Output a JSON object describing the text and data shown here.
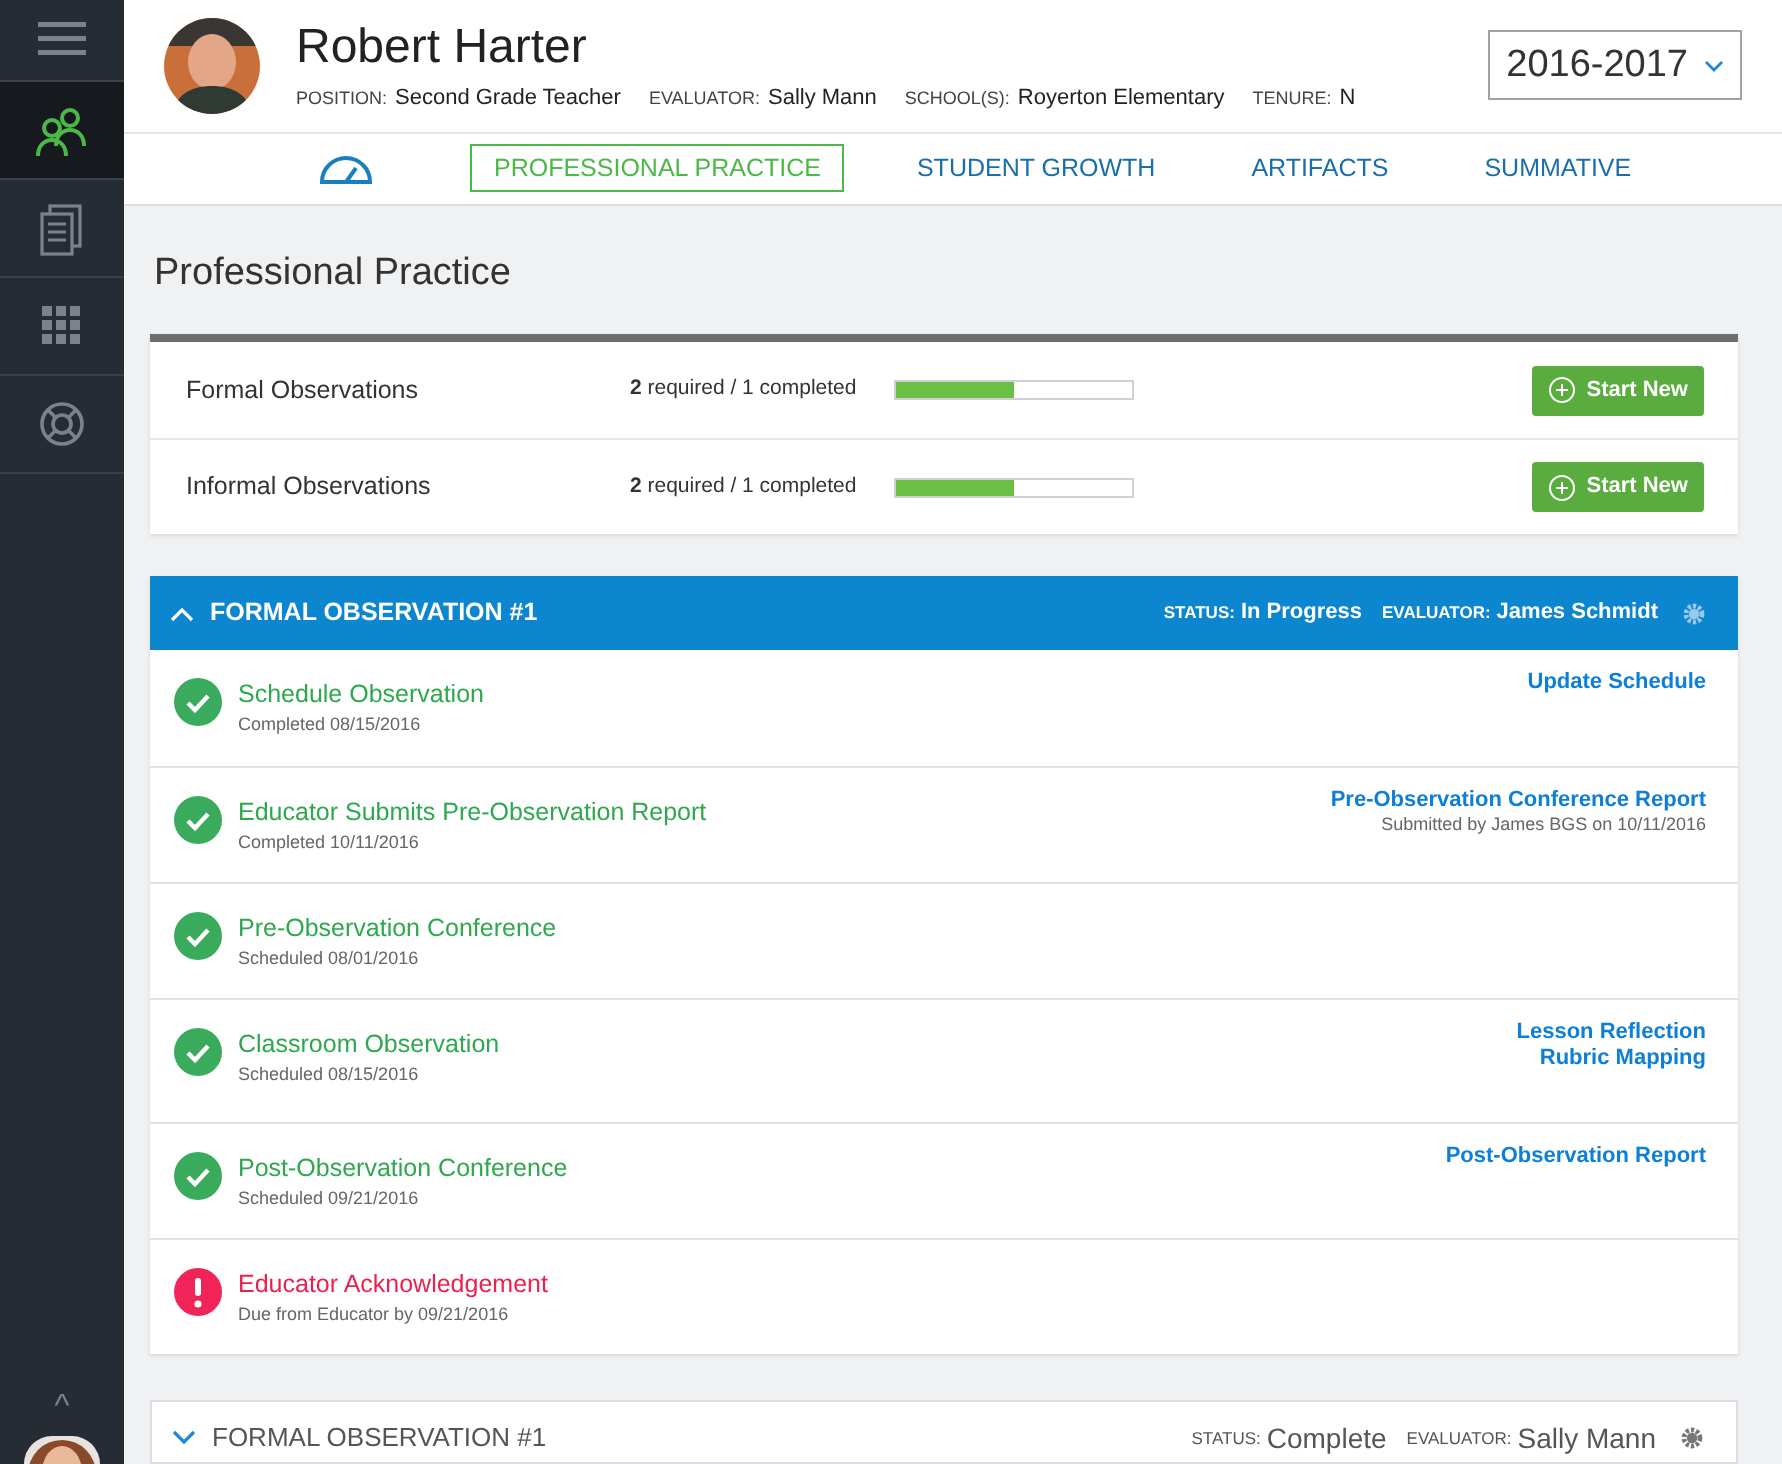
{
  "sidebar": {
    "items": [
      {
        "selected": false
      },
      {
        "selected": true
      },
      {
        "selected": false
      },
      {
        "selected": false
      },
      {
        "selected": false
      }
    ],
    "collapse": "^"
  },
  "profile": {
    "name": "Robert Harter",
    "fields": [
      {
        "label": "POSITION:",
        "value": "Second Grade Teacher"
      },
      {
        "label": "EVALUATOR:",
        "value": "Sally Mann"
      },
      {
        "label": "SCHOOL(S):",
        "value": "Royerton Elementary"
      },
      {
        "label": "TENURE:",
        "value": "N"
      }
    ],
    "year": "2016-2017"
  },
  "tabs": [
    {
      "kind": "icon",
      "selected": false
    },
    {
      "label": "PROFESSIONAL PRACTICE",
      "selected": true
    },
    {
      "label": "STUDENT GROWTH",
      "selected": false
    },
    {
      "label": "ARTIFACTS",
      "selected": false
    },
    {
      "label": "SUMMATIVE",
      "selected": false
    }
  ],
  "page_title": "Professional Practice",
  "summary": [
    {
      "name": "Formal Observations",
      "required": "2",
      "progress": "required / 1 completed",
      "level": 0.5,
      "button": "Start New"
    },
    {
      "name": "Informal Observations",
      "required": "2",
      "progress": "required / 1 completed",
      "level": 0.5,
      "button": "Start New"
    }
  ],
  "observations": [
    {
      "title": "FORMAL OBSERVATION #1",
      "expanded": true,
      "status_label": "STATUS:",
      "status": "In Progress",
      "evaluator_label": "EVALUATOR:",
      "evaluator": "James Schmidt",
      "steps": [
        {
          "kind": "done",
          "title": "Schedule Observation",
          "detail": "Completed 08/15/2016",
          "links": [
            "Update Schedule"
          ]
        },
        {
          "kind": "done",
          "title": "Educator Submits Pre-Observation Report",
          "detail": "Completed 10/11/2016",
          "links": [
            "Pre-Observation Conference Report"
          ],
          "note": "Submitted by James BGS on 10/11/2016"
        },
        {
          "kind": "done",
          "title": "Pre-Observation Conference",
          "detail": "Scheduled 08/01/2016"
        },
        {
          "kind": "done",
          "title": "Classroom Observation",
          "detail": "Scheduled 08/15/2016",
          "links": [
            "Lesson Reflection",
            "Rubric Mapping"
          ]
        },
        {
          "kind": "done",
          "title": "Post-Observation Conference",
          "detail": "Scheduled 09/21/2016",
          "links": [
            "Post-Observation Report"
          ]
        },
        {
          "kind": "alert",
          "title": "Educator Acknowledgement",
          "detail": "Due from Educator by 09/21/2016"
        }
      ]
    },
    {
      "title": "FORMAL OBSERVATION #1",
      "expanded": false,
      "status_label": "STATUS:",
      "status": "Complete",
      "evaluator_label": "EVALUATOR:",
      "evaluator": "Sally Mann"
    }
  ]
}
